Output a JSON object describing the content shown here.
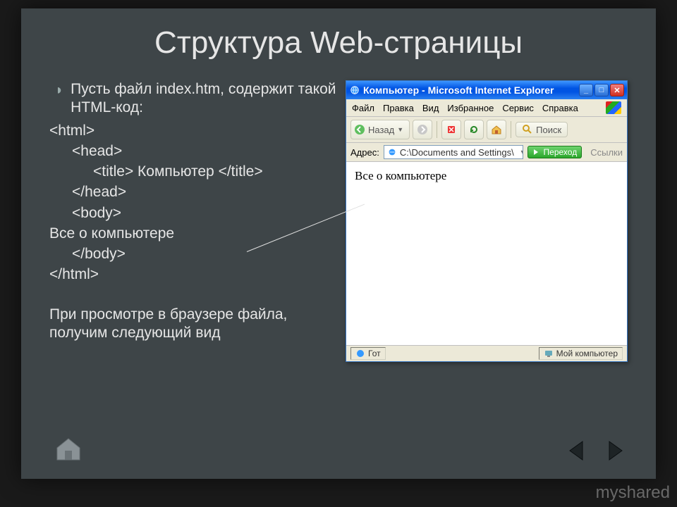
{
  "slide": {
    "title": "Структура Web-страницы",
    "bullet": "Пусть  файл index.htm, содержит такой HTML-код:",
    "code": {
      "l1": "<html>",
      "l2": "<head>",
      "l3": "<title> Компьютер </title>",
      "l4": "</head>",
      "l5": "<body>",
      "l6": "Все о компьютере",
      "l7": "</body>",
      "l8": "</html>"
    },
    "note": "При просмотре в браузере файла, получим следующий вид"
  },
  "browser": {
    "title": "Компьютер - Microsoft Internet Explorer",
    "menu": {
      "file": "Файл",
      "edit": "Правка",
      "view": "Вид",
      "favorites": "Избранное",
      "tools": "Сервис",
      "help": "Справка"
    },
    "toolbar": {
      "back": "Назад",
      "search": "Поиск"
    },
    "address": {
      "label": "Адрес:",
      "value": "C:\\Documents and Settings\\",
      "go": "Переход",
      "links": "Ссылки"
    },
    "page_text": "Все о компьютере",
    "status": {
      "ready": "Гот",
      "zone": "Мой компьютер"
    }
  },
  "watermark": "myshared"
}
